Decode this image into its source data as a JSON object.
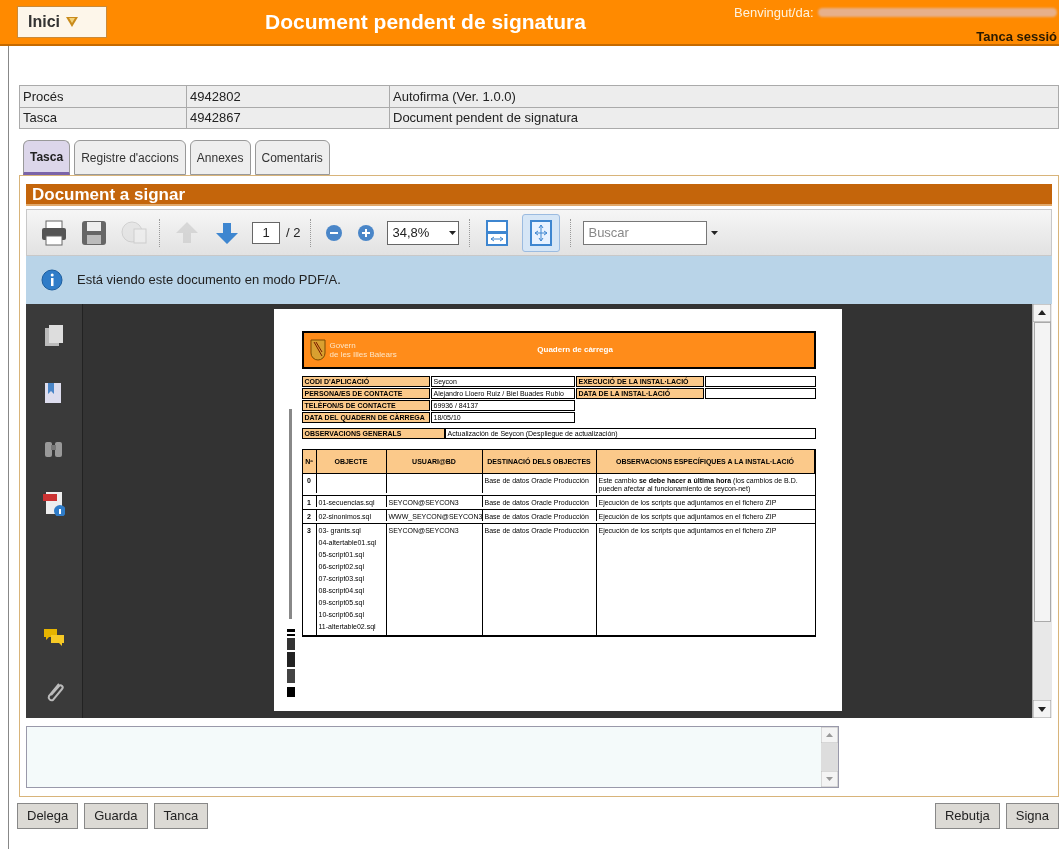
{
  "header": {
    "menu_button": "Inici",
    "title": "Document pendent de signatura",
    "welcome": "Benvingut/da:",
    "logout": "Tanca sessió"
  },
  "info_rows": [
    {
      "label": "Procés",
      "id": "4942802",
      "value": "Autofirma (Ver. 1.0.0)"
    },
    {
      "label": "Tasca",
      "id": "4942867",
      "value": "Document pendent de signatura"
    }
  ],
  "tabs": [
    {
      "label": "Tasca",
      "selected": true
    },
    {
      "label": "Registre d'accions",
      "selected": false
    },
    {
      "label": "Annexes",
      "selected": false
    },
    {
      "label": "Comentaris",
      "selected": false
    }
  ],
  "panel_title": "Document a signar",
  "toolbar": {
    "tools": [
      {
        "kind": "print",
        "disabled": false
      },
      {
        "kind": "save",
        "disabled": false
      },
      {
        "kind": "globe",
        "disabled": true
      },
      {
        "kind": "sep"
      },
      {
        "kind": "up",
        "disabled": true
      },
      {
        "kind": "down",
        "disabled": false
      },
      {
        "kind": "page"
      },
      {
        "kind": "sep"
      },
      {
        "kind": "zoomout",
        "disabled": false
      },
      {
        "kind": "zoomin",
        "disabled": false
      },
      {
        "kind": "zoom"
      },
      {
        "kind": "sep"
      },
      {
        "kind": "fitwidth",
        "selected": false
      },
      {
        "kind": "fitpage",
        "selected": true
      },
      {
        "kind": "sep"
      },
      {
        "kind": "search"
      }
    ],
    "page_value": "1",
    "page_total": "/ 2",
    "zoom": "34,8%",
    "search_placeholder": "Buscar"
  },
  "notice": "Está viendo este documento en modo PDF/A.",
  "document": {
    "org": [
      "Govern",
      "de les Illes Balears"
    ],
    "title": "Quadern de càrrega",
    "fields": [
      [
        "CODI D'APLICACIÓ",
        "Seycon",
        "EXECUCIÓ DE LA INSTAL·LACIÓ"
      ],
      [
        "PERSONA/ES DE CONTACTE",
        "Alejandro Lloero Ruiz / Biel Buades Rubio",
        "DATA DE LA INSTAL·LACIÓ"
      ],
      [
        "TELÈFON/S DE CONTACTE",
        "69936 / 84137"
      ],
      [
        "DATA DEL QUADERN DE CÀRREGA",
        "18/05/10"
      ]
    ],
    "general_label": "OBSERVACIONS GENERALS",
    "general_value": "Actualización de Seycon (Despliegue de actualización)",
    "columns": [
      "Nº",
      "OBJECTE",
      "USUARI@BD",
      "DESTINACIÓ DELS OBJECTES",
      "OBSERVACIONS ESPECÍFIQUES A LA INSTAL·LACIÓ"
    ],
    "rows": [
      {
        "n": "0",
        "objects": [],
        "user": "",
        "dest": "Base de datos Oracle Producción",
        "obs": "Este cambio **se debe hacer a última hora** (los cambios de B.D. pueden afectar al funcionamiento de seycon-net)"
      },
      {
        "n": "1",
        "objects": [
          "01-secuencias.sql"
        ],
        "user": "SEYCON@SEYCON3",
        "dest": "Base de datos Oracle Producción",
        "obs": "Ejecución de los scripts que adjuntamos en el fichero ZIP"
      },
      {
        "n": "2",
        "objects": [
          "02-sinonimos.sql"
        ],
        "user": "WWW_SEYCON@SEYCON3",
        "dest": "Base de datos Oracle Producción",
        "obs": "Ejecución de los scripts que adjuntamos en el fichero ZIP"
      },
      {
        "n": "3",
        "objects": [
          "03- grants.sql",
          "04-altertable01.sql",
          "05-script01.sql",
          "06-script02.sql",
          "07-script03.sql",
          "08-script04.sql",
          "09-script05.sql",
          "10-script06.sql",
          "11-altertable02.sql"
        ],
        "user": "SEYCON@SEYCON3",
        "dest": "Base de datos Oracle Producción",
        "obs": "Ejecución de los scripts que adjuntamos en el fichero ZIP"
      }
    ]
  },
  "left_buttons": [
    "Delega",
    "Guarda",
    "Tanca"
  ],
  "right_buttons": [
    "Rebutja",
    "Signa"
  ]
}
